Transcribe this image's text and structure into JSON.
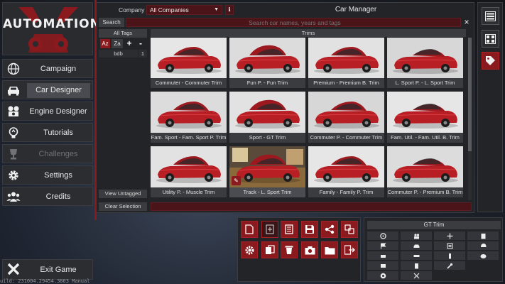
{
  "logo": {
    "text": "AUTOMATION"
  },
  "menu": [
    {
      "id": "campaign",
      "label": "Campaign",
      "icon": "globe-icon"
    },
    {
      "id": "car-designer",
      "label": "Car Designer",
      "icon": "car-icon",
      "highlighted": true
    },
    {
      "id": "engine-designer",
      "label": "Engine Designer",
      "icon": "engine-icon"
    },
    {
      "id": "tutorials",
      "label": "Tutorials",
      "icon": "lightbulb-icon"
    },
    {
      "id": "challenges",
      "label": "Challenges",
      "icon": "trophy-icon",
      "disabled": true
    },
    {
      "id": "settings",
      "label": "Settings",
      "icon": "gear-icon"
    },
    {
      "id": "credits",
      "label": "Credits",
      "icon": "people-icon"
    }
  ],
  "exit": {
    "label": "Exit Game",
    "icon": "x-icon"
  },
  "header": {
    "company_label": "Company",
    "company_value": "All Companies",
    "title": "Car Manager"
  },
  "search": {
    "label": "Search",
    "placeholder": "Search car names, years and tags",
    "close": "×"
  },
  "tags": {
    "all_label": "All Tags",
    "sort_az": "Az",
    "sort_za": "Za",
    "add": "+",
    "remove": "-",
    "items": [
      {
        "name": "bdb",
        "count": "1"
      }
    ]
  },
  "trims_header": "Trims",
  "cars": [
    "Commuter - Commuter Trim",
    "Fun P. - Fun Trim",
    "Premium - Premium B. Trim",
    "L. Sport P. - L. Sport Trim",
    "Fam. Sport - Fam. Sport P. Trim",
    "Sport - GT Trim",
    "Commuter P. - Commuter Trim",
    "Fam. Util. - Fam. Util. B. Trim",
    "Utility P. - Muscle Trim",
    "Track - L. Sport Trim",
    "Family - Family P. Trim",
    "Commuter P. - Premium B. Trim",
    "",
    "",
    "",
    ""
  ],
  "buttons": {
    "view_untagged": "View Untagged",
    "clear_selection": "Clear Selection"
  },
  "gt_panel": {
    "title": "GT Trim"
  },
  "build": "uild: 231004.29454.3803 Manual",
  "colors": {
    "accent": "#8b1a1e",
    "car_red": "#b81f25",
    "panel": "#232428"
  }
}
